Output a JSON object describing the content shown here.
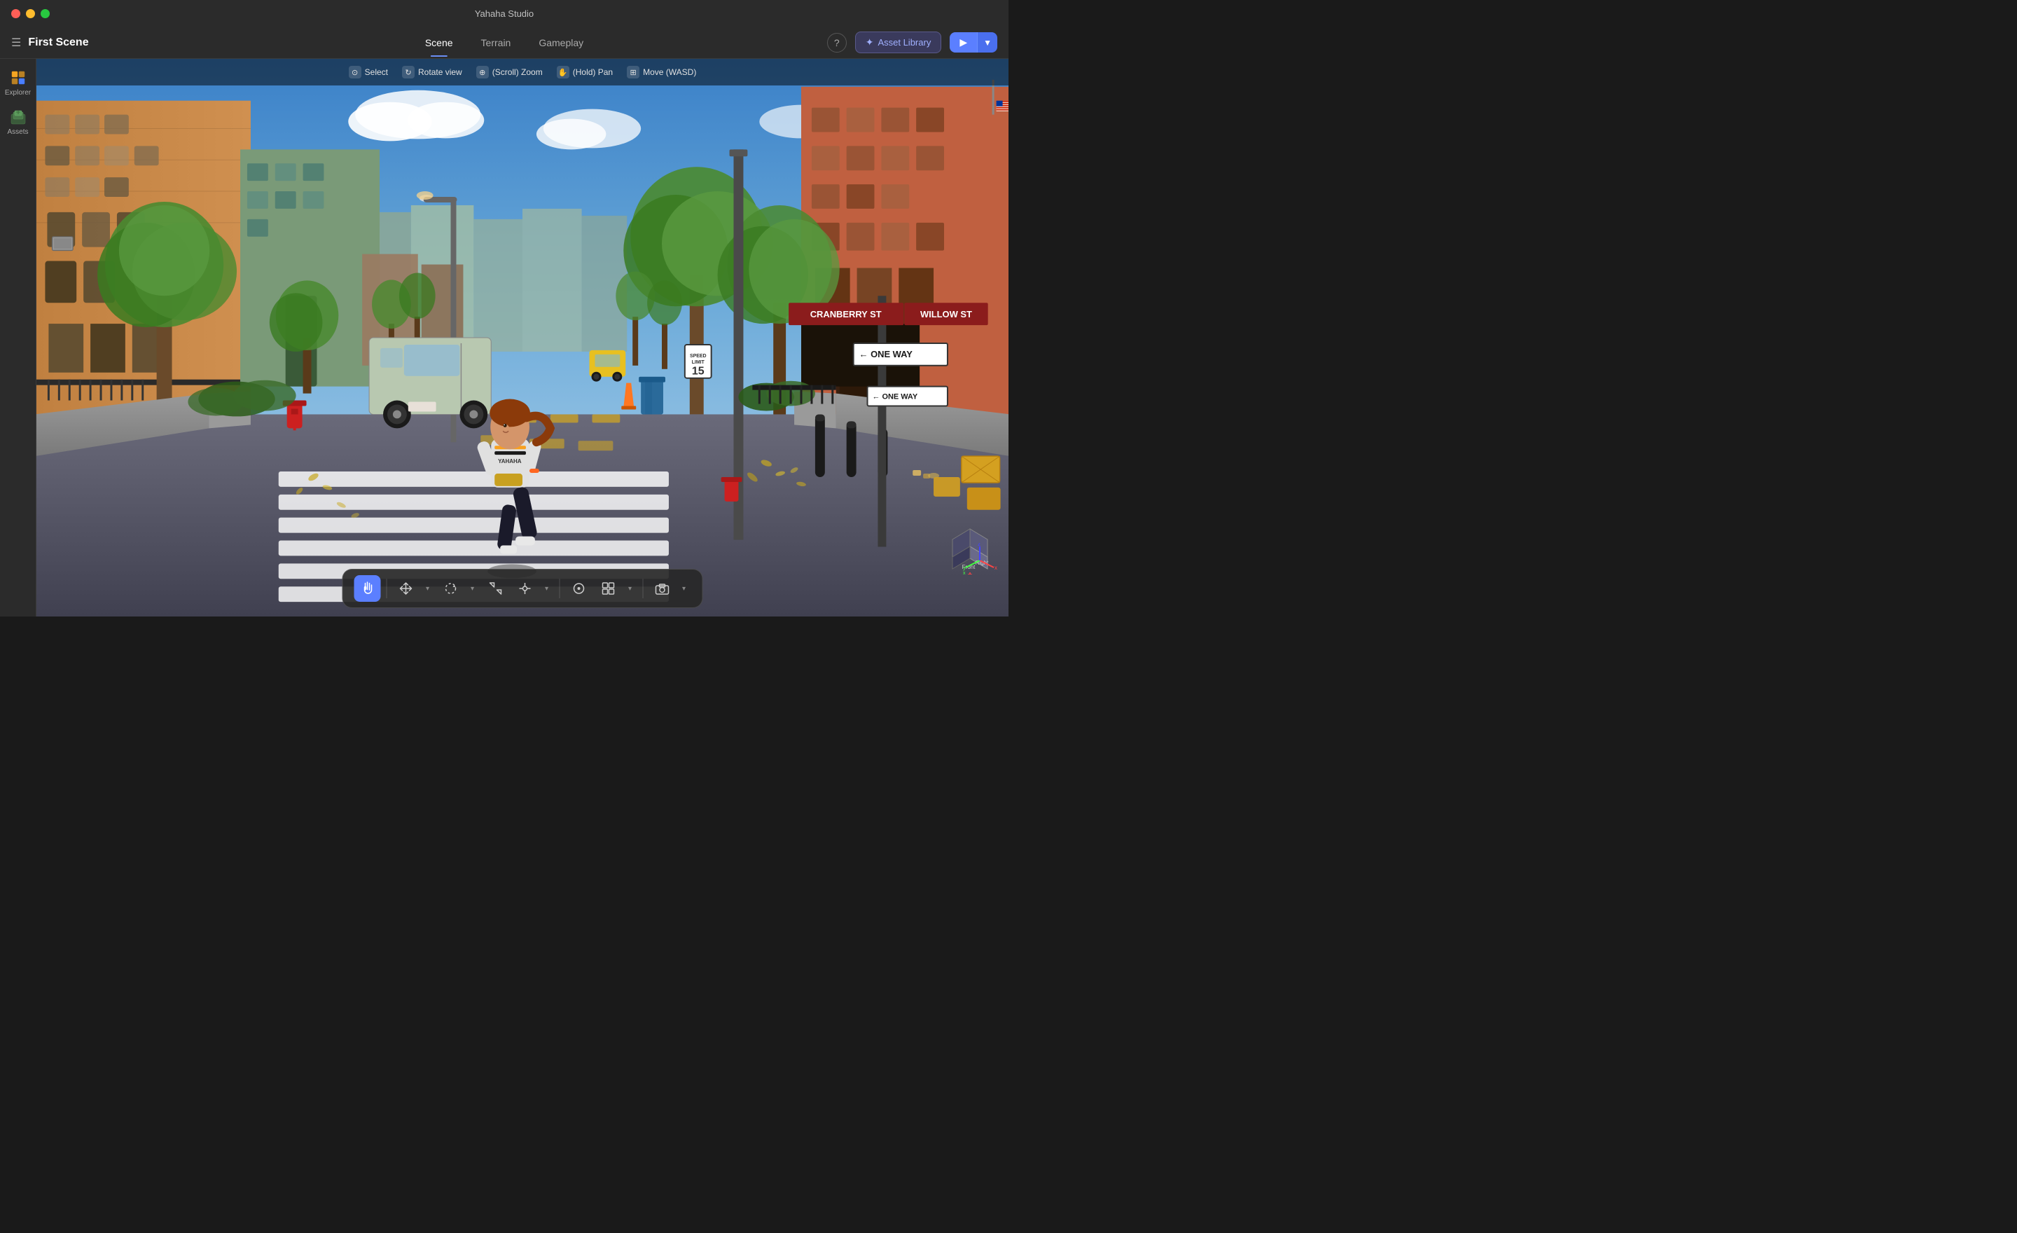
{
  "window": {
    "title": "Yahaha Studio"
  },
  "titlebar": {
    "title": "Yahaha Studio"
  },
  "topnav": {
    "scene_title": "First Scene",
    "tabs": [
      {
        "id": "scene",
        "label": "Scene",
        "active": true
      },
      {
        "id": "terrain",
        "label": "Terrain",
        "active": false
      },
      {
        "id": "gameplay",
        "label": "Gameplay",
        "active": false
      }
    ],
    "help_label": "?",
    "asset_library_label": "Asset Library",
    "play_label": "▶",
    "play_dropdown_label": "▼"
  },
  "sidebar": {
    "items": [
      {
        "id": "explorer",
        "label": "Explorer",
        "icon": "🗂"
      },
      {
        "id": "assets",
        "label": "Assets",
        "icon": "📦"
      }
    ]
  },
  "viewport": {
    "toolbar": {
      "select_label": "Select",
      "rotate_view_label": "Rotate view",
      "scroll_zoom_label": "(Scroll) Zoom",
      "hold_pan_label": "(Hold) Pan",
      "move_wasd_label": "Move (WASD)"
    },
    "signs": {
      "cranberry_st": "CRANBERRY ST",
      "willow_st": "WILLOW ST",
      "one_way_1": "ONE WAY",
      "one_way_2": "ONE WAY"
    },
    "orient_cube": {
      "front_label": "Front",
      "right_label": "Right"
    }
  },
  "bottom_toolbar": {
    "tools": [
      {
        "id": "hand",
        "icon": "✋",
        "active": true,
        "label": "Hand"
      },
      {
        "id": "move",
        "icon": "✛",
        "active": false,
        "label": "Move"
      },
      {
        "id": "rotate",
        "icon": "↻",
        "active": false,
        "label": "Rotate"
      },
      {
        "id": "scale",
        "icon": "⤢",
        "active": false,
        "label": "Scale"
      },
      {
        "id": "transform",
        "icon": "⊕",
        "active": false,
        "label": "Transform"
      },
      {
        "id": "sep1",
        "type": "separator"
      },
      {
        "id": "snap",
        "icon": "⊙",
        "active": false,
        "label": "Snap"
      },
      {
        "id": "grid",
        "icon": "⊞",
        "active": false,
        "label": "Grid"
      },
      {
        "id": "sep2",
        "type": "separator"
      },
      {
        "id": "camera",
        "icon": "□",
        "active": false,
        "label": "Camera"
      }
    ]
  }
}
